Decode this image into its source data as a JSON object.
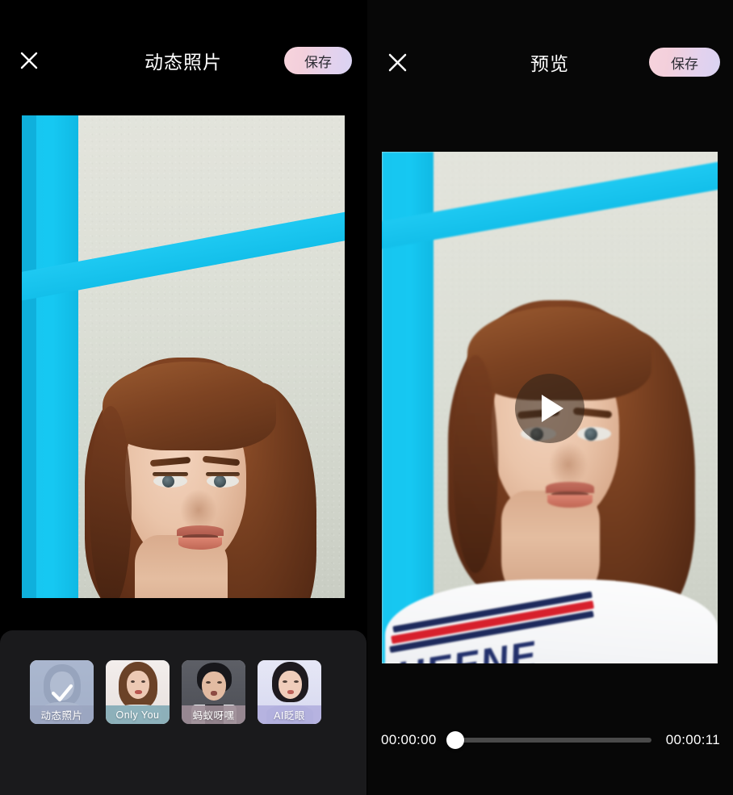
{
  "left_panel": {
    "close_icon": "close-x-icon",
    "title": "动态照片",
    "save_label": "保存"
  },
  "right_panel": {
    "close_icon": "close-x-icon",
    "title": "预览",
    "save_label": "保存",
    "play_icon": "play-triangle-icon"
  },
  "timeline": {
    "current_time": "00:00:00",
    "total_time": "00:00:11",
    "progress_percent": 0
  },
  "effects": {
    "items": [
      {
        "label": "动态照片",
        "selected": true,
        "label_bg": "#9aa5bf",
        "thumb_bg": "#b9c2d4"
      },
      {
        "label": "Only You",
        "selected": false,
        "label_bg": "#7fa8b4",
        "thumb_bg": "#efe9e8"
      },
      {
        "label": "蚂蚁呀嘿",
        "selected": false,
        "label_bg": "#9c8c96",
        "thumb_bg": "#57585e"
      },
      {
        "label": "AI眨眼",
        "selected": false,
        "label_bg": "#b3b0de",
        "thumb_bg": "#dfe0f2"
      }
    ],
    "check_icon": "checkmark-icon"
  },
  "theme": {
    "background": "#000000",
    "tray_background": "#1a1a1c",
    "save_gradient_start": "#f7d4dd",
    "save_gradient_end": "#d9d3f2",
    "accent_cyan": "#16c8f2",
    "text_primary": "#ffffff"
  },
  "photo": {
    "shirt_text": "UEENE",
    "description": "portrait-photo"
  }
}
